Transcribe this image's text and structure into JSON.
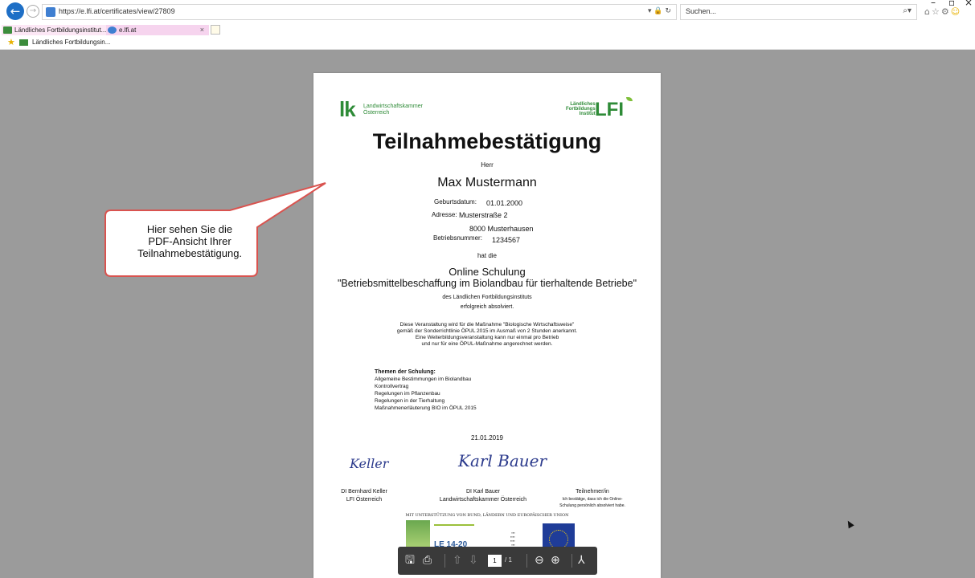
{
  "browser": {
    "url": "https://e.lfi.at/certificates/view/27809",
    "search_placeholder": "Suchen...",
    "tabs": [
      {
        "label": "Ländliches Fortbildungsinstitut..."
      },
      {
        "label": "e.lfi.at"
      }
    ],
    "favorites": [
      {
        "label": "Ländliches Fortbildungsin..."
      }
    ],
    "icons": {
      "back": "back-arrow-icon",
      "forward": "forward-arrow-icon",
      "search": "search-icon",
      "home": "home-icon",
      "star": "favorites-star-icon",
      "settings": "gear-icon",
      "smiley": "feedback-smiley-icon"
    }
  },
  "certificate": {
    "logo_left_mark": "lk",
    "logo_left_text": [
      "Landwirtschaftskammer",
      "Österreich"
    ],
    "logo_right_small": [
      "Ländliches",
      "Fortbildungs",
      "Institut"
    ],
    "logo_right_big": "LFI",
    "title": "Teilnahmebestätigung",
    "salutation": "Herr",
    "name": "Max Mustermann",
    "birth_label": "Geburtsdatum:",
    "birth_value": "01.01.2000",
    "address_label": "Adresse:",
    "address_line1": "Musterstraße 2",
    "address_line2": "8000 Musterhausen",
    "farm_label": "Betriebsnummer:",
    "farm_value": "1234567",
    "hat_die": "hat die",
    "course_type": "Online Schulung",
    "course_title": "\"Betriebsmittelbeschaffung im Biolandbau für tierhaltende Betriebe\"",
    "institute_line1": "des Ländlichen Fortbildungsinstituts",
    "institute_line2": "erfolgreich absolviert.",
    "notice": [
      "Diese Veranstaltung wird für die Maßnahme \"Biologische Wirtschaftsweise\"",
      "gemäß der Sonderrichtlinie ÖPUL 2015 im Ausmaß von 2 Stunden anerkannt.",
      "Eine Weiterbildungsveranstaltung kann nur einmal pro Betrieb",
      "und nur für eine ÖPUL-Maßnahme angerechnet werden."
    ],
    "topics_heading": "Themen der Schulung:",
    "topics": [
      "Allgemeine Bestimmungen im Biolandbau",
      "Kontrollvertrag",
      "Regelungen im Pflanzenbau",
      "Regelungen in der Tierhaltung",
      "Maßnahmenerläuterung BIO im ÖPUL 2015"
    ],
    "date": "21.01.2019",
    "signature1_script": "Keller",
    "signature2_script": "Karl Bauer",
    "signer1": [
      "DI Bernhard Keller",
      "LFI Österreich"
    ],
    "signer2": [
      "DI Karl Bauer",
      "Landwirtschaftskammer Österreich"
    ],
    "participant": [
      "Teilnehmer/in",
      "Ich bestätige, dass ich die Online-",
      "Schulung persönlich absolviert habe."
    ],
    "eu_support": "MIT UNTERSTÜTZUNG VON BUND, LÄNDERN UND EUROPÄISCHER UNION",
    "le_logo": "LE 14-20"
  },
  "callout": {
    "lines": [
      "Hier sehen Sie die",
      "PDF-Ansicht Ihrer",
      "Teilnahmebestätigung."
    ],
    "color": "#d9534f"
  },
  "pdf_toolbar": {
    "current_page": "1",
    "total_pages": "/ 1",
    "icons": [
      "save-icon",
      "print-icon",
      "page-up-icon",
      "page-down-icon",
      "zoom-out-icon",
      "zoom-in-icon",
      "acrobat-icon"
    ]
  }
}
